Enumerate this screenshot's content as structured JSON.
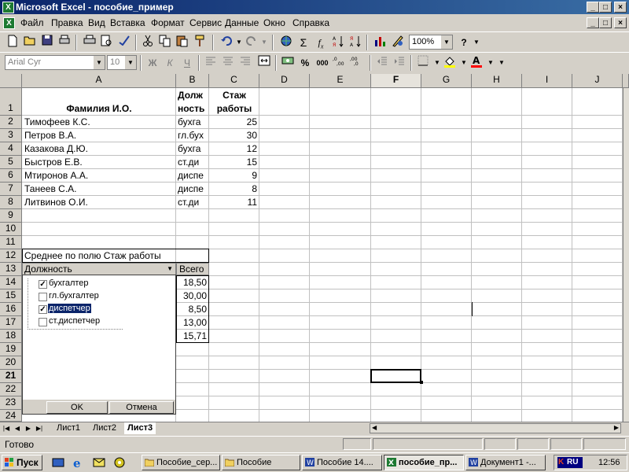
{
  "window": {
    "title": "Microsoft Excel - пособие_пример",
    "app_icon_letter": "X",
    "min": "_",
    "max": "□",
    "close": "×"
  },
  "menu": [
    "Файл",
    "Правка",
    "Вид",
    "Вставка",
    "Формат",
    "Сервис",
    "Данные",
    "Окно",
    "Справка"
  ],
  "toolbar": {
    "zoom": "100%",
    "font_name": "Arial Cyr",
    "font_size": "10",
    "bold_label": "Ж",
    "italic_label": "К",
    "underline_label": "Ч",
    "percent_label": "%",
    "thousands_label": "000"
  },
  "columns": [
    "A",
    "B",
    "C",
    "D",
    "E",
    "F",
    "G",
    "H",
    "I",
    "J"
  ],
  "rows": [
    "1",
    "2",
    "3",
    "4",
    "5",
    "6",
    "7",
    "8",
    "9",
    "10",
    "11",
    "12",
    "13",
    "14",
    "15",
    "16",
    "17",
    "18",
    "19",
    "20",
    "21",
    "22",
    "23",
    "24"
  ],
  "header": {
    "name": "Фамилия И.О.",
    "position_line1": "Долж",
    "position_line2": "ность",
    "tenure_line1": "Стаж",
    "tenure_line2": "работы"
  },
  "employees": [
    {
      "name": "Тимофеев К.С.",
      "position": "бухга",
      "tenure": "25"
    },
    {
      "name": "Петров В.А.",
      "position": "гл.бух",
      "tenure": "30"
    },
    {
      "name": "Казакова Д.Ю.",
      "position": "бухга",
      "tenure": "12"
    },
    {
      "name": "Быстров Е.В.",
      "position": "ст.ди",
      "tenure": "15"
    },
    {
      "name": "Мтиронов А.А.",
      "position": "диспе",
      "tenure": "9"
    },
    {
      "name": "Танеев С.А.",
      "position": "диспе",
      "tenure": "8"
    },
    {
      "name": "Литвинов  О.И.",
      "position": "ст.ди",
      "tenure": "11"
    }
  ],
  "pivot": {
    "title": "Среднее по полю Стаж работы",
    "field": "Должность",
    "total_label": "Всего",
    "values": [
      "18,50",
      "30,00",
      "8,50",
      "13,00",
      "15,71"
    ],
    "filter_items": [
      {
        "label": "бухгалтер",
        "checked": true
      },
      {
        "label": "гл.бухгалтер",
        "checked": false
      },
      {
        "label": "диспетчер",
        "checked": true
      },
      {
        "label": "ст.диспетчер",
        "checked": false
      }
    ],
    "ok": "OK",
    "cancel": "Отмена"
  },
  "sheets": [
    "Лист1",
    "Лист2",
    "Лист3"
  ],
  "active_sheet": "Лист3",
  "status": "Готово",
  "taskbar": {
    "start": "Пуск",
    "tasks": [
      {
        "label": "Пособие_сер...",
        "active": false
      },
      {
        "label": "Пособие",
        "active": false
      },
      {
        "label": "Пособие 14....",
        "active": false
      },
      {
        "label": "пособие_пр...",
        "active": true
      },
      {
        "label": "Документ1 -...",
        "active": false
      }
    ],
    "lang": "RU",
    "clock": "12:56"
  }
}
